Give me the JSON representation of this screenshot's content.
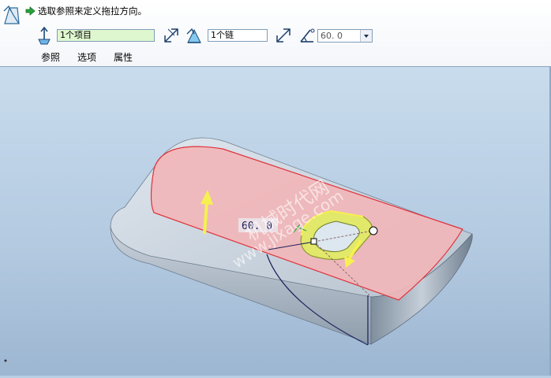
{
  "message": {
    "text": "选取参照来定义拖拉方向。",
    "icon": "green-arrow-icon"
  },
  "toolbar": {
    "direction_reference_value": "1个项目",
    "chain_value": "1个链",
    "angle_value": "60. 0"
  },
  "tabs": [
    {
      "label": "参照"
    },
    {
      "label": "选项"
    },
    {
      "label": "属性"
    }
  ],
  "viewport": {
    "angle_label": "60. 0",
    "watermark_cn": "机械时代网",
    "watermark_url": "www.jixage.com"
  },
  "colors": {
    "face_highlight": "#f2b6b8",
    "edge_highlight": "#e0303a",
    "drag_arrow": "#f6f052",
    "selected_chain": "#d6e552",
    "part_body": "#c3ced8"
  }
}
